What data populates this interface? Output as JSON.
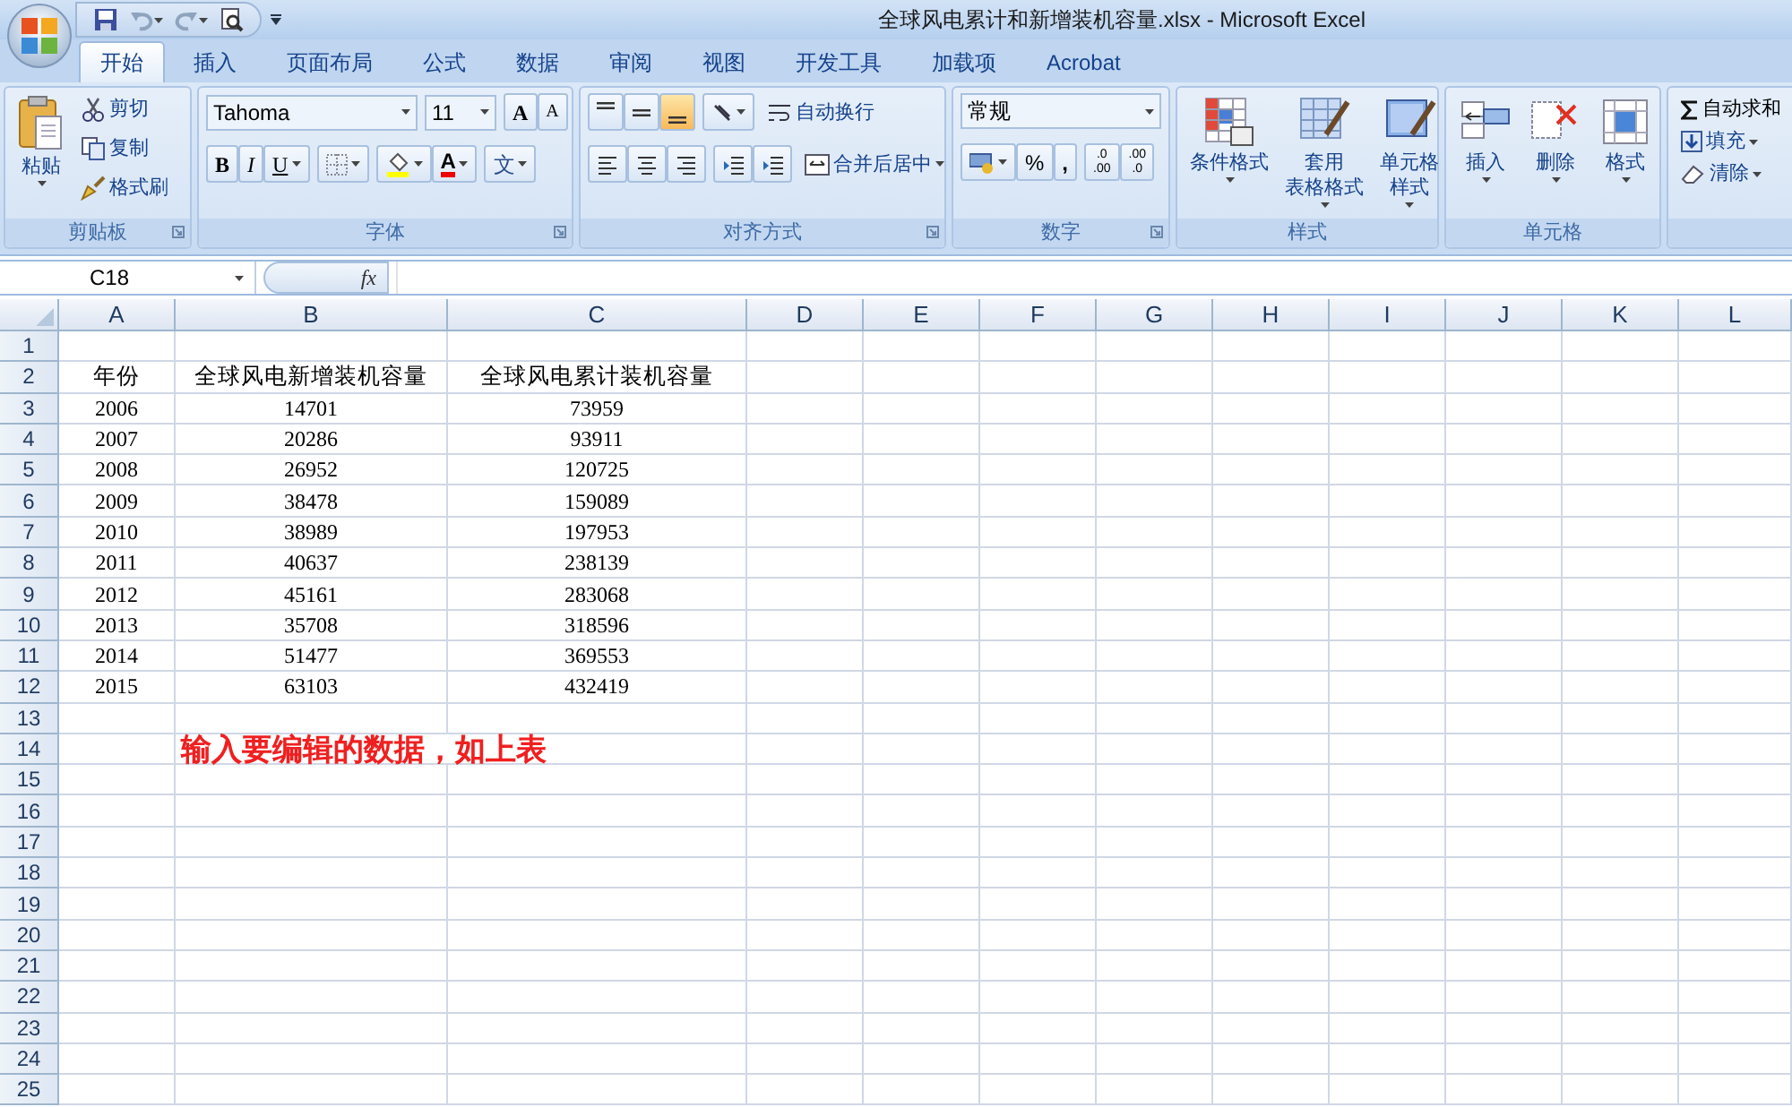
{
  "title": "全球风电累计和新增装机容量.xlsx - Microsoft Excel",
  "tabs": [
    {
      "label": "开始",
      "selected": true
    },
    {
      "label": "插入",
      "selected": false
    },
    {
      "label": "页面布局",
      "selected": false
    },
    {
      "label": "公式",
      "selected": false
    },
    {
      "label": "数据",
      "selected": false
    },
    {
      "label": "审阅",
      "selected": false
    },
    {
      "label": "视图",
      "selected": false
    },
    {
      "label": "开发工具",
      "selected": false
    },
    {
      "label": "加载项",
      "selected": false
    },
    {
      "label": "Acrobat",
      "selected": false
    }
  ],
  "clipboard": {
    "label": "剪贴板",
    "paste": "粘贴",
    "cut": "剪切",
    "copy": "复制",
    "format_painter": "格式刷"
  },
  "font": {
    "label": "字体",
    "font_name": "Tahoma",
    "font_size": "11",
    "grow": "A",
    "shrink": "A",
    "bold": "B",
    "italic": "I",
    "underline": "U",
    "font_color": "A",
    "phonetic": "文"
  },
  "alignment": {
    "label": "对齐方式",
    "vertical": [
      {
        "selected": false
      },
      {
        "selected": false
      },
      {
        "selected": true
      }
    ],
    "wrap_text": "自动换行",
    "merge_center": "合并后居中"
  },
  "number": {
    "label": "数字",
    "format": "常规",
    "percent": "%",
    "comma": ",",
    "increase_decimal": [
      ".0",
      ".00"
    ],
    "decrease_decimal": [
      ".00",
      ".0"
    ]
  },
  "styles": {
    "label": "样式",
    "conditional_format": "条件格式",
    "table_format": [
      "套用",
      "表格格式"
    ],
    "cell_styles": [
      "单元格",
      "样式"
    ]
  },
  "cells": {
    "label": "单元格",
    "insert": "插入",
    "delete": "删除",
    "format": "格式"
  },
  "editing": {
    "autosum": "自动求和",
    "fill": "填充",
    "clear": "清除"
  },
  "formula_bar": {
    "name_box": "C18",
    "fx": "fx"
  },
  "sheet": {
    "columns": [
      "A",
      "B",
      "C",
      "D",
      "E",
      "F",
      "G",
      "H",
      "I",
      "J",
      "K",
      "L"
    ],
    "rows": [
      {
        "number": "1"
      },
      {
        "number": "2",
        "cells": [
          "年份",
          "全球风电新增装机容量",
          "全球风电累计装机容量"
        ]
      },
      {
        "number": "3",
        "cells": [
          "2006",
          "14701",
          "73959"
        ]
      },
      {
        "number": "4",
        "cells": [
          "2007",
          "20286",
          "93911"
        ]
      },
      {
        "number": "5",
        "cells": [
          "2008",
          "26952",
          "120725"
        ]
      },
      {
        "number": "6",
        "cells": [
          "2009",
          "38478",
          "159089"
        ]
      },
      {
        "number": "7",
        "cells": [
          "2010",
          "38989",
          "197953"
        ]
      },
      {
        "number": "8",
        "cells": [
          "2011",
          "40637",
          "238139"
        ]
      },
      {
        "number": "9",
        "cells": [
          "2012",
          "45161",
          "283068"
        ]
      },
      {
        "number": "10",
        "cells": [
          "2013",
          "35708",
          "318596"
        ]
      },
      {
        "number": "11",
        "cells": [
          "2014",
          "51477",
          "369553"
        ]
      },
      {
        "number": "12",
        "cells": [
          "2015",
          "63103",
          "432419"
        ]
      },
      {
        "number": "13"
      },
      {
        "number": "14",
        "note": "输入要编辑的数据，如上表"
      },
      {
        "number": "15"
      },
      {
        "number": "16"
      },
      {
        "number": "17"
      },
      {
        "number": "18"
      },
      {
        "number": "19"
      },
      {
        "number": "20"
      },
      {
        "number": "21"
      },
      {
        "number": "22"
      },
      {
        "number": "23"
      },
      {
        "number": "24"
      },
      {
        "number": "25"
      }
    ]
  }
}
